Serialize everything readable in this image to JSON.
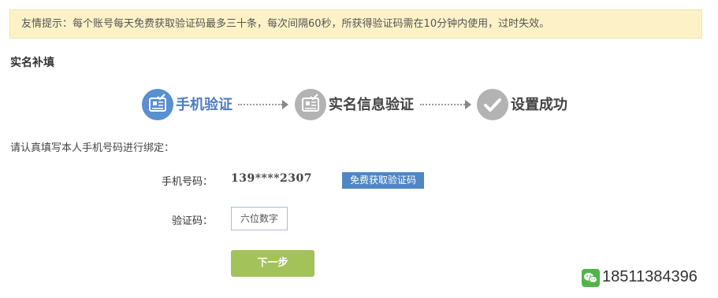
{
  "notice": {
    "text": "友情提示：每个账号每天免费获取验证码最多三十条，每次间隔60秒，所获得验证码需在10分钟内使用，过时失效。"
  },
  "section_title": "实名补填",
  "steps": [
    {
      "label": "手机验证",
      "icon": "id-card-check-icon",
      "state": "active"
    },
    {
      "label": "实名信息验证",
      "icon": "id-card-check-icon",
      "state": "inactive"
    },
    {
      "label": "设置成功",
      "icon": "checkmark-icon",
      "state": "inactive"
    }
  ],
  "instruction": "请认真填写本人手机号码进行绑定：",
  "form": {
    "phone_label": "手机号码：",
    "phone_value": "139****2307",
    "get_code_button": "免费获取验证码",
    "code_label": "验证码：",
    "code_placeholder": "六位数字",
    "next_button": "下一步"
  },
  "contact": {
    "icon": "wechat-icon",
    "number": "18511384396"
  },
  "colors": {
    "notice_bg": "#fdf2c7",
    "active_step": "#4f7cc2",
    "inactive_step": "#b3b3b3",
    "code_button": "#4f86c6",
    "next_button": "#a4c25a",
    "wechat_green": "#4fb54a"
  }
}
